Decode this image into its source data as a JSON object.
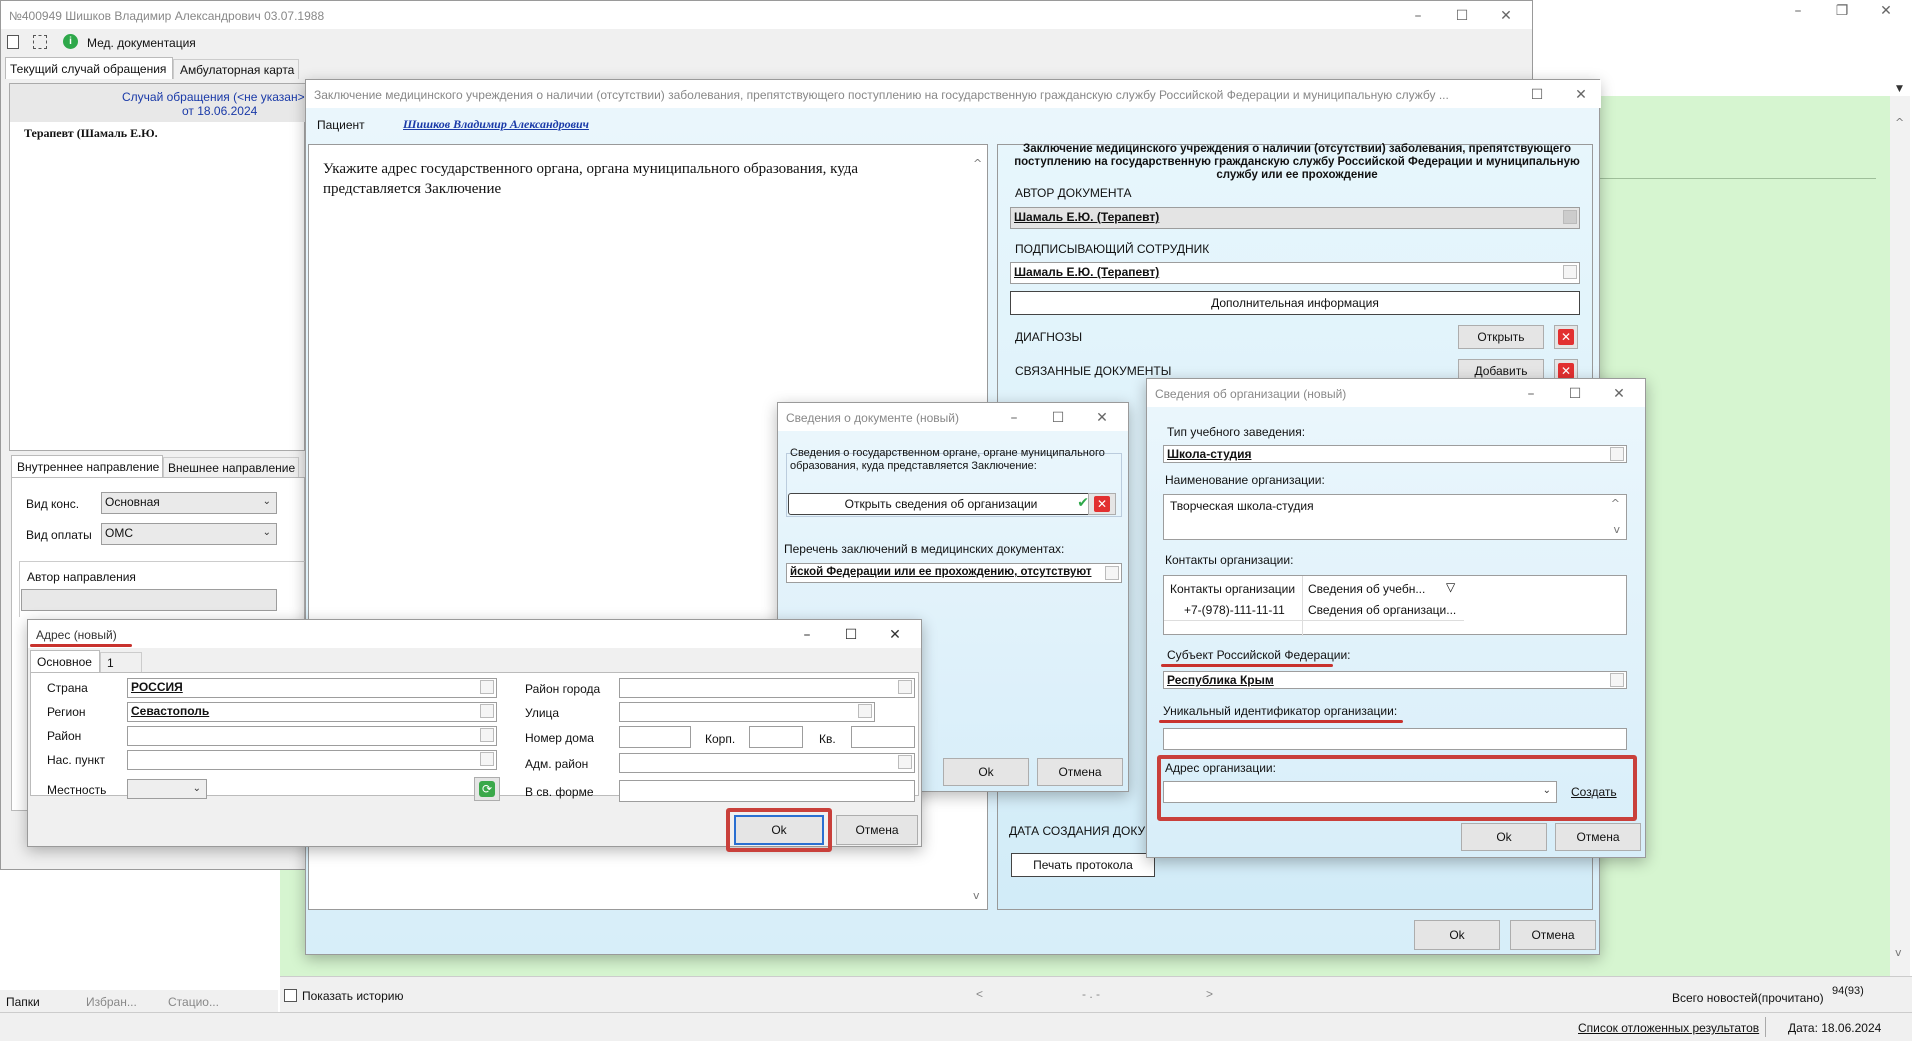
{
  "app": {
    "title": "№400949 Шишков Владимир Александрович 03.07.1988",
    "toolbar_med_docs": "Мед. документация",
    "tabs": [
      "Текущий случай обращения",
      "Амбулаторная карта"
    ],
    "case_link": "Случай обращения (<не указан>",
    "case_date": "от 18.06.2024",
    "tree_item": "Терапевт (Шамаль Е.Ю.",
    "direction_tabs": [
      "Внутреннее направление",
      "Внешнее направление"
    ],
    "vid_kons_label": "Вид конс.",
    "vid_kons_value": "Основная",
    "vid_oplaty_label": "Вид оплаты",
    "vid_oplaty_value": "ОМС",
    "author_label": "Автор направления",
    "bottom_tabs": [
      "Папки",
      "Избран...",
      "Стацио..."
    ],
    "show_history": "Показать историю",
    "pager_prev": "<",
    "pager_mid": "- . -",
    "pager_next": ">",
    "news_label": "Всего новостей(прочитано)",
    "news_count": "94(93)",
    "deferred_results": "Список отложенных результатов",
    "date_status": "Дата: 18.06.2024"
  },
  "conclusion": {
    "title": "Заключение медицинского учреждения о наличии (отсутствии) заболевания, препятствующего поступлению на государственную гражданскую службу Российской Федерации и муниципальную службу ...",
    "patient_label": "Пациент",
    "patient_name": "Шишков Владимир Александрович",
    "instruction": "Укажите адрес государственного органа, органа муниципального образования, куда представляется Заключение",
    "doc_header": "Заключение медицинского учреждения о наличии (отсутствии) заболевания, препятствующего поступлению на государственную гражданскую службу Российской Федерации и муниципальную службу или ее прохождение",
    "author_heading": "АВТОР ДОКУМЕНТА",
    "author_value": "Шамаль Е.Ю. (Терапевт)",
    "signer_heading": "ПОДПИСЫВАЮЩИЙ СОТРУДНИК",
    "signer_value": "Шамаль Е.Ю. (Терапевт)",
    "extra_info": "Дополнительная информация",
    "diagnoses": "ДИАГНОЗЫ",
    "open": "Открыть",
    "related_docs": "СВЯЗАННЫЕ ДОКУМЕНТЫ",
    "add": "Добавить",
    "created_date": "ДАТА СОЗДАНИЯ ДОКУМ",
    "print_protocol": "Печать протокола",
    "ok": "Ok",
    "cancel": "Отмена"
  },
  "doc_info": {
    "title": "Сведения о документе (новый)",
    "group_text": "Сведения о государственном органе, органе муниципального образования, куда представляется Заключение:",
    "open_org": "Открыть сведения об организации",
    "list_label": "Перечень заключений в медицинских документах:",
    "list_value": "йской Федерации или ее прохождению, отсутствуют",
    "ok": "Ok",
    "cancel": "Отмена"
  },
  "org_info": {
    "title": "Сведения об организации (новый)",
    "type_label": "Тип учебного заведения:",
    "type_value": "Школа-студия",
    "name_label": "Наименование организации:",
    "name_value": "Творческая школа-студия",
    "contacts_label": "Контакты организации:",
    "contacts_header": [
      "Контакты организации",
      "Сведения об учебн..."
    ],
    "contacts_row": [
      "+7-(978)-111-11-11",
      "Сведения об организаци..."
    ],
    "subject_label": "Субъект Российской Федерации:",
    "subject_value": "Республика Крым",
    "uid_label": "Уникальный идентификатор организации:",
    "address_label": "Адрес организации:",
    "create": "Создать",
    "ok": "Ok",
    "cancel": "Отмена"
  },
  "address": {
    "title": "Адрес (новый)",
    "tab_main": "Основное",
    "tab_1": "1",
    "country_label": "Страна",
    "country_value": "РОССИЯ",
    "region_label": "Регион",
    "region_value": "Севастополь",
    "district_label": "Район",
    "settlement_label": "Нас. пункт",
    "locality_label": "Местность",
    "city_district_label": "Район города",
    "street_label": "Улица",
    "house_label": "Номер дома",
    "building_label": "Корп.",
    "apt_label": "Кв.",
    "adm_district_label": "Адм. район",
    "free_form_label": "В св. форме",
    "ok": "Ok",
    "cancel": "Отмена"
  },
  "colors": {
    "green_bg": "#d6f5d0",
    "highlight_red": "#c9403b",
    "link_blue": "#1a3aa8"
  }
}
